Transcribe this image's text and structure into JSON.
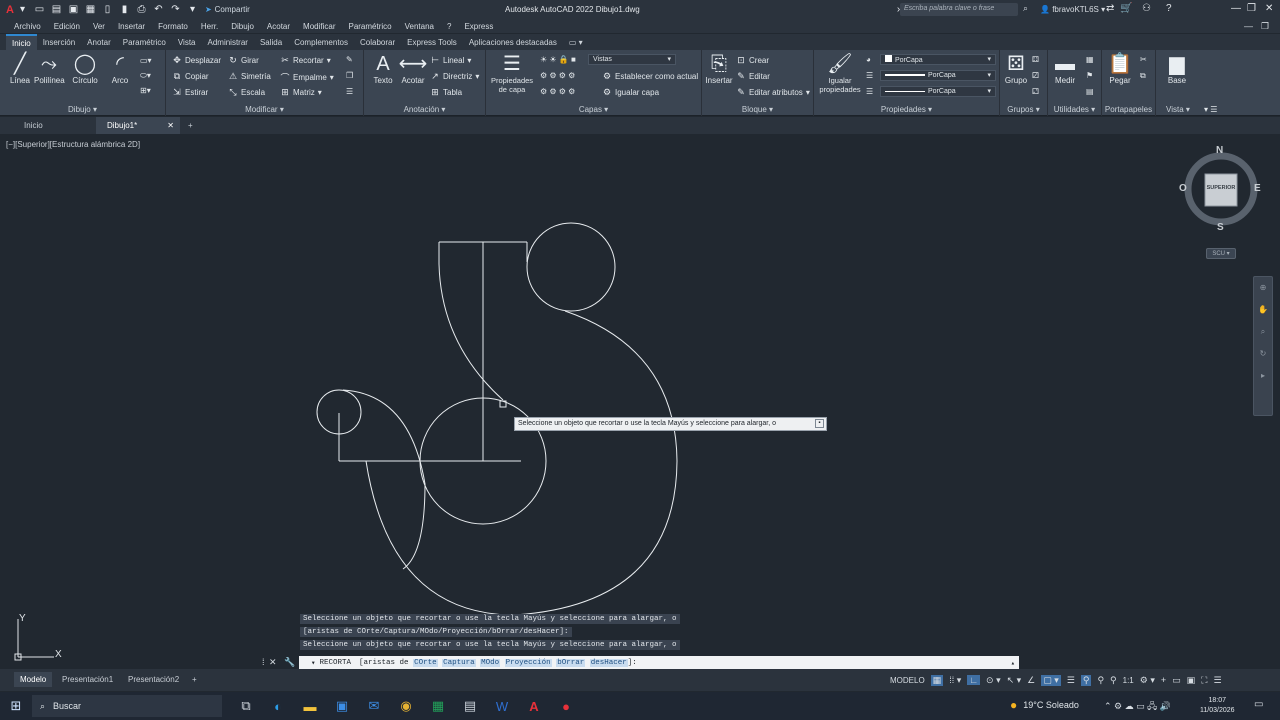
{
  "titlebar": {
    "app_logo": "A",
    "share": "Compartir",
    "title": "Autodesk AutoCAD 2022   Dibujo1.dwg",
    "search_placeholder": "Escriba palabra clave o frase",
    "user": "fbravoKTL6S"
  },
  "menu": [
    "Archivo",
    "Edición",
    "Ver",
    "Insertar",
    "Formato",
    "Herr.",
    "Dibujo",
    "Acotar",
    "Modificar",
    "Paramétrico",
    "Ventana",
    "?",
    "Express"
  ],
  "ribbon_tabs": [
    "Inicio",
    "Inserción",
    "Anotar",
    "Paramétrico",
    "Vista",
    "Administrar",
    "Salida",
    "Complementos",
    "Colaborar",
    "Express Tools",
    "Aplicaciones destacadas"
  ],
  "ribbon": {
    "dibujo": {
      "title": "Dibujo",
      "linea": "Línea",
      "polilinea": "Polilínea",
      "circulo": "Círculo",
      "arco": "Arco"
    },
    "modificar": {
      "title": "Modificar",
      "desplazar": "Desplazar",
      "girar": "Girar",
      "recortar": "Recortar",
      "copiar": "Copiar",
      "simetria": "Simetría",
      "empalme": "Empalme",
      "estirar": "Estirar",
      "escala": "Escala",
      "matriz": "Matriz"
    },
    "anotacion": {
      "title": "Anotación",
      "texto": "Texto",
      "acotar": "Acotar",
      "lineal": "Lineal",
      "directriz": "Directriz",
      "tabla": "Tabla"
    },
    "capas": {
      "title": "Capas",
      "propiedades": "Propiedades de capa",
      "vistas": "Vistas",
      "establecer": "Establecer como actual",
      "igualar": "Igualar capa"
    },
    "bloque": {
      "title": "Bloque",
      "insertar": "Insertar",
      "crear": "Crear",
      "editar": "Editar",
      "editar_atributos": "Editar atributos"
    },
    "propiedades": {
      "title": "Propiedades",
      "igualar": "Igualar propiedades",
      "porcapa1": "PorCapa",
      "porcapa2": "PorCapa",
      "porcapa3": "PorCapa"
    },
    "grupos": {
      "title": "Grupos",
      "grupo": "Grupo"
    },
    "utilidades": {
      "title": "Utilidades",
      "medir": "Medir"
    },
    "portapapeles": {
      "title": "Portapapeles",
      "pegar": "Pegar"
    },
    "vista": {
      "title": "Vista",
      "base": "Base"
    }
  },
  "doc_tabs": {
    "inicio": "Inicio",
    "dibujo": "Dibujo1*"
  },
  "viewport_label": "[−][Superior][Estructura alámbrica 2D]",
  "viewcube": {
    "n": "N",
    "s": "S",
    "e": "E",
    "o": "O",
    "face": "SUPERIOR",
    "scu": "SCU"
  },
  "tooltip": "Seleccione un objeto que recortar o use la tecla Mayús y seleccione para alargar, o",
  "command_history": [
    "Seleccione un objeto que recortar o use la tecla Mayús y seleccione para alargar, o",
    "[aristas de COrte/Captura/MOdo/Proyección/bOrrar/desHacer]:",
    "Seleccione un objeto que recortar o use la tecla Mayús y seleccione para alargar, o"
  ],
  "command_line": {
    "cmd": "RECORTA",
    "prefix": "[aristas de",
    "opt1": "COrte",
    "opt2": "Captura",
    "opt3": "MOdo",
    "opt4": "Proyección",
    "opt5": "bOrrar",
    "opt6": "desHacer",
    "suffix": "]:"
  },
  "layout_tabs": [
    "Modelo",
    "Presentación1",
    "Presentación2"
  ],
  "status": {
    "modelo": "MODELO",
    "scale": "1:1"
  },
  "taskbar": {
    "search": "Buscar",
    "weather": "19°C  Soleado",
    "time": "18:07",
    "date": "11/03/2026"
  },
  "ucs": {
    "x": "X",
    "y": "Y"
  }
}
